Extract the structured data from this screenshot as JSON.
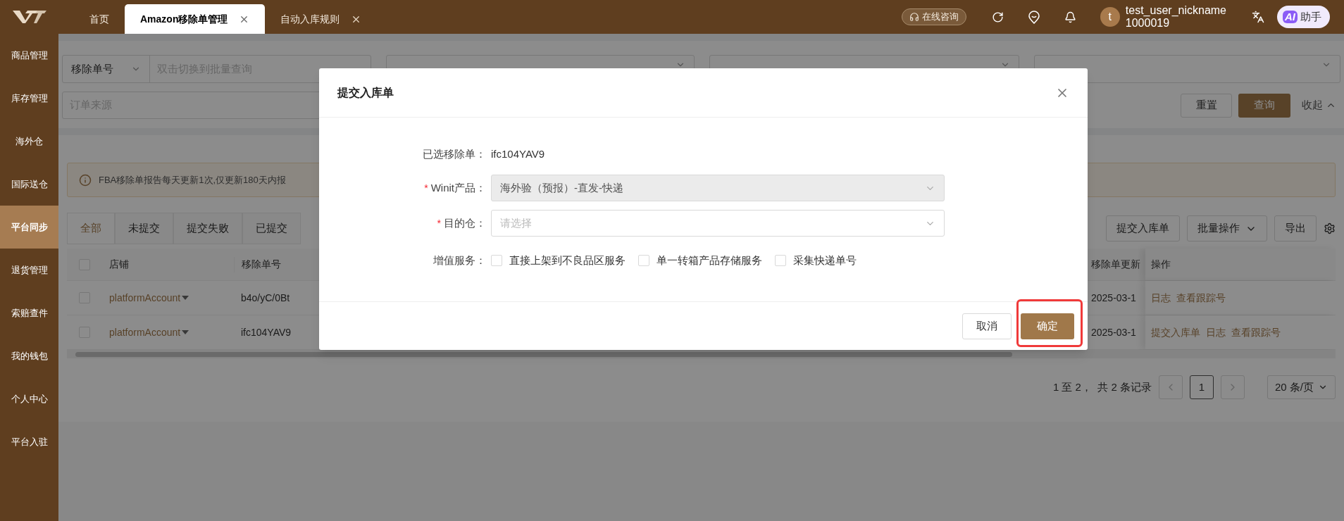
{
  "top_bar": {
    "tabs": [
      {
        "label": "首页",
        "selected": false,
        "closable": false
      },
      {
        "label": "Amazon移除单管理",
        "selected": true,
        "closable": true
      },
      {
        "label": "自动入库规则",
        "selected": false,
        "closable": true
      }
    ],
    "consult_button": "在线咨询",
    "user": {
      "avatar": "t",
      "name": "test_user_nickname",
      "id": "1000019"
    },
    "ai_button": {
      "badge": "AI",
      "label": "助手"
    }
  },
  "sidebar": {
    "items": [
      {
        "label": "商品管理",
        "selected": false
      },
      {
        "label": "库存管理",
        "selected": false
      },
      {
        "label": "海外仓",
        "selected": false
      },
      {
        "label": "国际送仓",
        "selected": false
      },
      {
        "label": "平台同步",
        "selected": true
      },
      {
        "label": "退货管理",
        "selected": false
      },
      {
        "label": "索赔查件",
        "selected": false
      },
      {
        "label": "我的钱包",
        "selected": false
      },
      {
        "label": "个人中心",
        "selected": false
      },
      {
        "label": "平台入驻",
        "selected": false
      }
    ]
  },
  "filters": {
    "search_type": "移除单号",
    "search_placeholder": "双击切换到批量查询",
    "source_placeholder": "订单来源",
    "reset_button": "重置",
    "query_button": "查询",
    "collapse_button": "收起"
  },
  "notice": "FBA移除单报告每天更新1次,仅更新180天内报",
  "status_tabs": [
    {
      "label": "全部",
      "selected": true
    },
    {
      "label": "未提交",
      "selected": false
    },
    {
      "label": "提交失败",
      "selected": false
    },
    {
      "label": "已提交",
      "selected": false
    }
  ],
  "actions": [
    "提交入库单",
    "批量操作",
    "导出"
  ],
  "table": {
    "header_checked": false,
    "columns": [
      "店铺",
      "移除单号",
      "移除单更新",
      "操作"
    ],
    "rows": [
      {
        "checked": false,
        "store": "platformAccount",
        "order_no": "b4o/yC/0Bt",
        "updated": "2025-03-1",
        "actions": [
          "日志",
          "查看跟踪号"
        ]
      },
      {
        "checked": false,
        "store": "platformAccount",
        "order_no": "ifc104YAV9",
        "updated": "2025-03-1",
        "actions": [
          "提交入库单",
          "日志",
          "查看跟踪号"
        ]
      }
    ]
  },
  "pagination": {
    "summary": "1 至 2，  共 2 条记录",
    "pages": [
      {
        "label": "1",
        "selected": true
      }
    ],
    "page_size": "20 条/页"
  },
  "dialog": {
    "title": "提交入库单",
    "fields": [
      {
        "kind": "text",
        "label": "已选移除单：",
        "value": "ifc104YAV9"
      },
      {
        "kind": "select",
        "label": "Winit产品：",
        "value": "海外验（预报）-直发-快递",
        "required_mark": "*",
        "disabled": true
      },
      {
        "kind": "select",
        "label": "目的仓：",
        "placeholder": "请选择",
        "required_mark": "*",
        "disabled": false
      },
      {
        "kind": "checkboxes",
        "label": "增值服务：",
        "options": [
          {
            "label": "直接上架到不良品区服务",
            "checked": false
          },
          {
            "label": "单一转箱产品存储服务",
            "checked": false
          },
          {
            "label": "采集快递单号",
            "checked": false
          }
        ]
      }
    ],
    "cancel_button": "取消",
    "ok_button": {
      "label": "确定",
      "highlighted": true
    }
  }
}
